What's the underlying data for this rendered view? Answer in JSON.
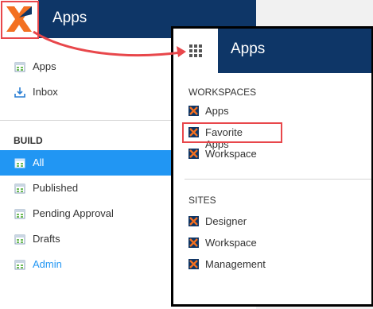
{
  "header": {
    "title": "Apps"
  },
  "sidebar": {
    "top_items": [
      {
        "label": "Apps",
        "icon": "app-grid-icon"
      },
      {
        "label": "Inbox",
        "icon": "inbox-download-icon"
      }
    ],
    "build_section_label": "BUILD",
    "build_items": [
      {
        "label": "All",
        "state": "active"
      },
      {
        "label": "Published"
      },
      {
        "label": "Pending Approval"
      },
      {
        "label": "Drafts"
      },
      {
        "label": "Admin",
        "state": "link"
      }
    ]
  },
  "callout": {
    "title": "Apps",
    "workspaces_label": "WORKSPACES",
    "workspaces": [
      {
        "label": "Apps"
      },
      {
        "label": "Favorite Apps",
        "highlighted": true
      },
      {
        "label": "Workspace"
      }
    ],
    "sites_label": "SITES",
    "sites": [
      {
        "label": "Designer"
      },
      {
        "label": "Workspace"
      },
      {
        "label": "Management"
      }
    ]
  },
  "colors": {
    "header_bg": "#0e3667",
    "active_bg": "#2196f3",
    "highlight": "#e8474b",
    "logo_orange": "#f37021"
  }
}
